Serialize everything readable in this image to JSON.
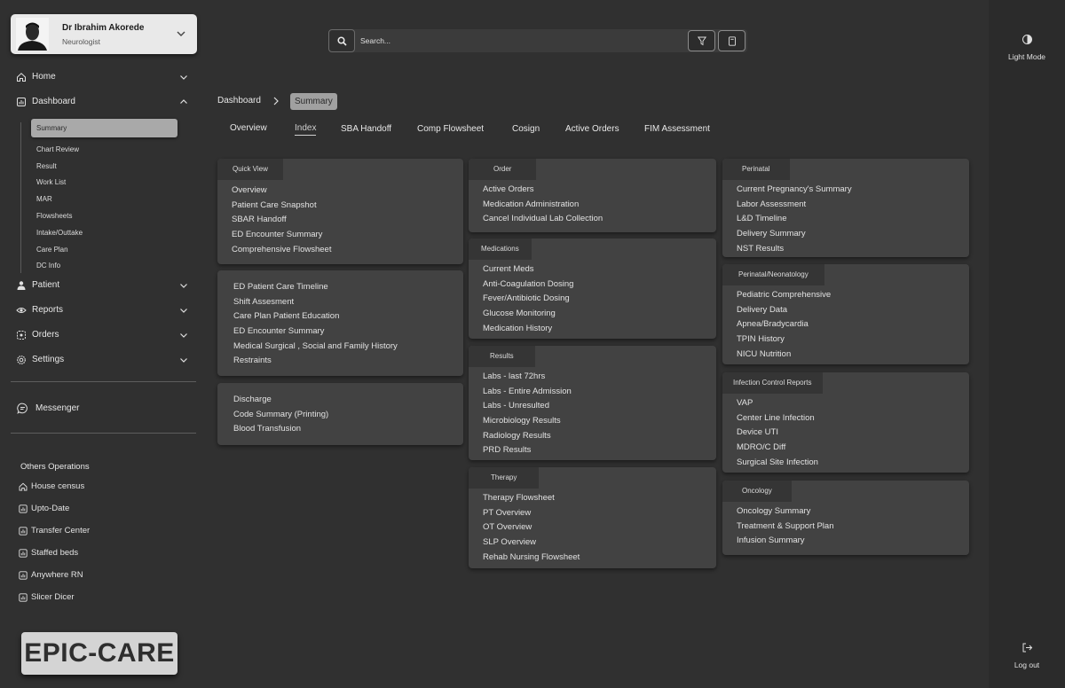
{
  "profile": {
    "name": "Dr Ibrahim Akorede",
    "role": "Neurologist"
  },
  "nav": {
    "home": "Home",
    "dashboard": "Dashboard",
    "dashboard_sub": [
      "Summary",
      "Chart Review",
      "Result",
      "Work List",
      "MAR",
      "Flowsheets",
      "Intake/Outtake",
      "Care Plan",
      "DC Info"
    ],
    "patient": "Patient",
    "reports": "Reports",
    "orders": "Orders",
    "settings": "Settings",
    "messenger": "Messenger"
  },
  "others": {
    "title": "Others Operations",
    "items": [
      "House census",
      "Upto-Date",
      "Transfer Center",
      "Staffed beds",
      "Anywhere RN",
      "Slicer Dicer"
    ]
  },
  "logo": "EPIC-CARE",
  "search": {
    "placeholder": "Search..."
  },
  "right_rail": {
    "light_mode": "Light Mode",
    "logout": "Log out"
  },
  "breadcrumb": {
    "root": "Dashboard",
    "current": "Summary"
  },
  "tabs": [
    "Overview",
    "Index",
    "SBA Handoff",
    "Comp Flowsheet",
    "Cosign",
    "Active Orders",
    "FIM Assessment"
  ],
  "active_tab": "Index",
  "cards": {
    "quick_view": {
      "title": "Quick View",
      "items": [
        "Overview",
        "Patient Care Snapshot",
        "SBAR Handoff",
        "ED Encounter Summary",
        "Comprehensive Flowsheet"
      ]
    },
    "ed": {
      "items": [
        "ED Patient Care Timeline",
        "Shift Assesment",
        "Care Plan Patient Education",
        "ED Encounter Summary",
        "Medical Surgical , Social and Family History",
        "Restraints"
      ]
    },
    "discharge": {
      "items": [
        "Discharge",
        "Code Summary (Printing)",
        "Blood Transfusion"
      ]
    },
    "order": {
      "title": "Order",
      "items": [
        "Active Orders",
        "Medication Administration",
        "Cancel Individual Lab Collection"
      ]
    },
    "medications": {
      "title": "Medications",
      "items": [
        "Current Meds",
        "Anti-Coagulation Dosing",
        "Fever/Antibiotic Dosing",
        "Glucose Monitoring",
        "Medication History"
      ]
    },
    "results": {
      "title": "Results",
      "items": [
        "Labs - last 72hrs",
        "Labs - Entire Admission",
        "Labs - Unresulted",
        "Microbiology Results",
        "Radiology Results",
        "PRD Results"
      ]
    },
    "therapy": {
      "title": "Therapy",
      "items": [
        "Therapy Flowsheet",
        "PT Overview",
        "OT Overview",
        "SLP Overview",
        "Rehab Nursing Flowsheet"
      ]
    },
    "perinatal": {
      "title": "Perinatal",
      "items": [
        "Current Pregnancy's Summary",
        "Labor Assessment",
        "L&D Timeline",
        "Delivery Summary",
        "NST Results"
      ]
    },
    "neonatology": {
      "title": "Perinatal/Neonatology",
      "items": [
        "Pediatric Comprehensive",
        "Delivery Data",
        "Apnea/Bradycardia",
        "TPIN History",
        "NICU Nutrition"
      ]
    },
    "infection": {
      "title": "Infection Control Reports",
      "items": [
        "VAP",
        "Center Line Infection",
        "Device UTI",
        "MDRO/C Diff",
        "Surgical Site Infection"
      ]
    },
    "oncology": {
      "title": "Oncology",
      "items": [
        "Oncology Summary",
        "Treatment & Support Plan",
        "Infusion Summary"
      ]
    }
  }
}
